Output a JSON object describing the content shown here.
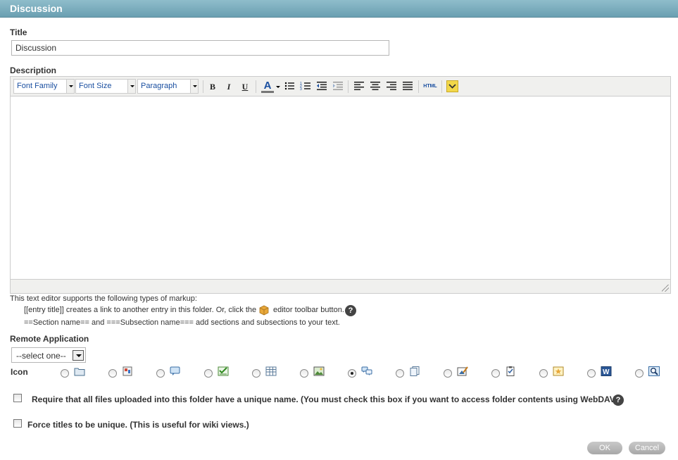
{
  "header": {
    "title": "Discussion"
  },
  "form": {
    "title_label": "Title",
    "title_value": "Discussion",
    "description_label": "Description"
  },
  "toolbar": {
    "font_family": "Font Family",
    "font_size": "Font Size",
    "paragraph": "Paragraph",
    "bold": "B",
    "italic": "I",
    "underline": "U",
    "text_color": "A",
    "html": "HTML"
  },
  "help": {
    "intro": "This text editor supports the following types of markup:",
    "line1_pre": "[[entry title]] creates a link to another entry in this folder. Or, click the",
    "line1_post": "editor toolbar button.",
    "line2": "==Section name== and ===Subsection name=== add sections and subsections to your text.",
    "help_glyph": "?"
  },
  "remote_app": {
    "label": "Remote Application",
    "selected": "--select one--"
  },
  "icon_picker": {
    "label": "Icon",
    "options": [
      {
        "icon": "folder-icon",
        "checked": false
      },
      {
        "icon": "bulletin-board-icon",
        "checked": false
      },
      {
        "icon": "speech-bubble-icon",
        "checked": false
      },
      {
        "icon": "checklist-icon",
        "checked": false
      },
      {
        "icon": "table-icon",
        "checked": false
      },
      {
        "icon": "picture-icon",
        "checked": false
      },
      {
        "icon": "discussion-bubbles-icon",
        "checked": true
      },
      {
        "icon": "documents-icon",
        "checked": false
      },
      {
        "icon": "image-edit-icon",
        "checked": false
      },
      {
        "icon": "clipboard-task-icon",
        "checked": false
      },
      {
        "icon": "star-note-icon",
        "checked": false
      },
      {
        "icon": "word-document-icon",
        "checked": false
      },
      {
        "icon": "magnifier-icon",
        "checked": false
      }
    ]
  },
  "options": {
    "unique_files_label": "Require that all files uploaded into this folder have a unique name. (You must check this box if you want to access folder contents using WebDAV.)",
    "unique_titles_label": "Force titles to be unique. (This is useful for wiki views.)"
  },
  "buttons": {
    "ok": "OK",
    "cancel": "Cancel"
  }
}
